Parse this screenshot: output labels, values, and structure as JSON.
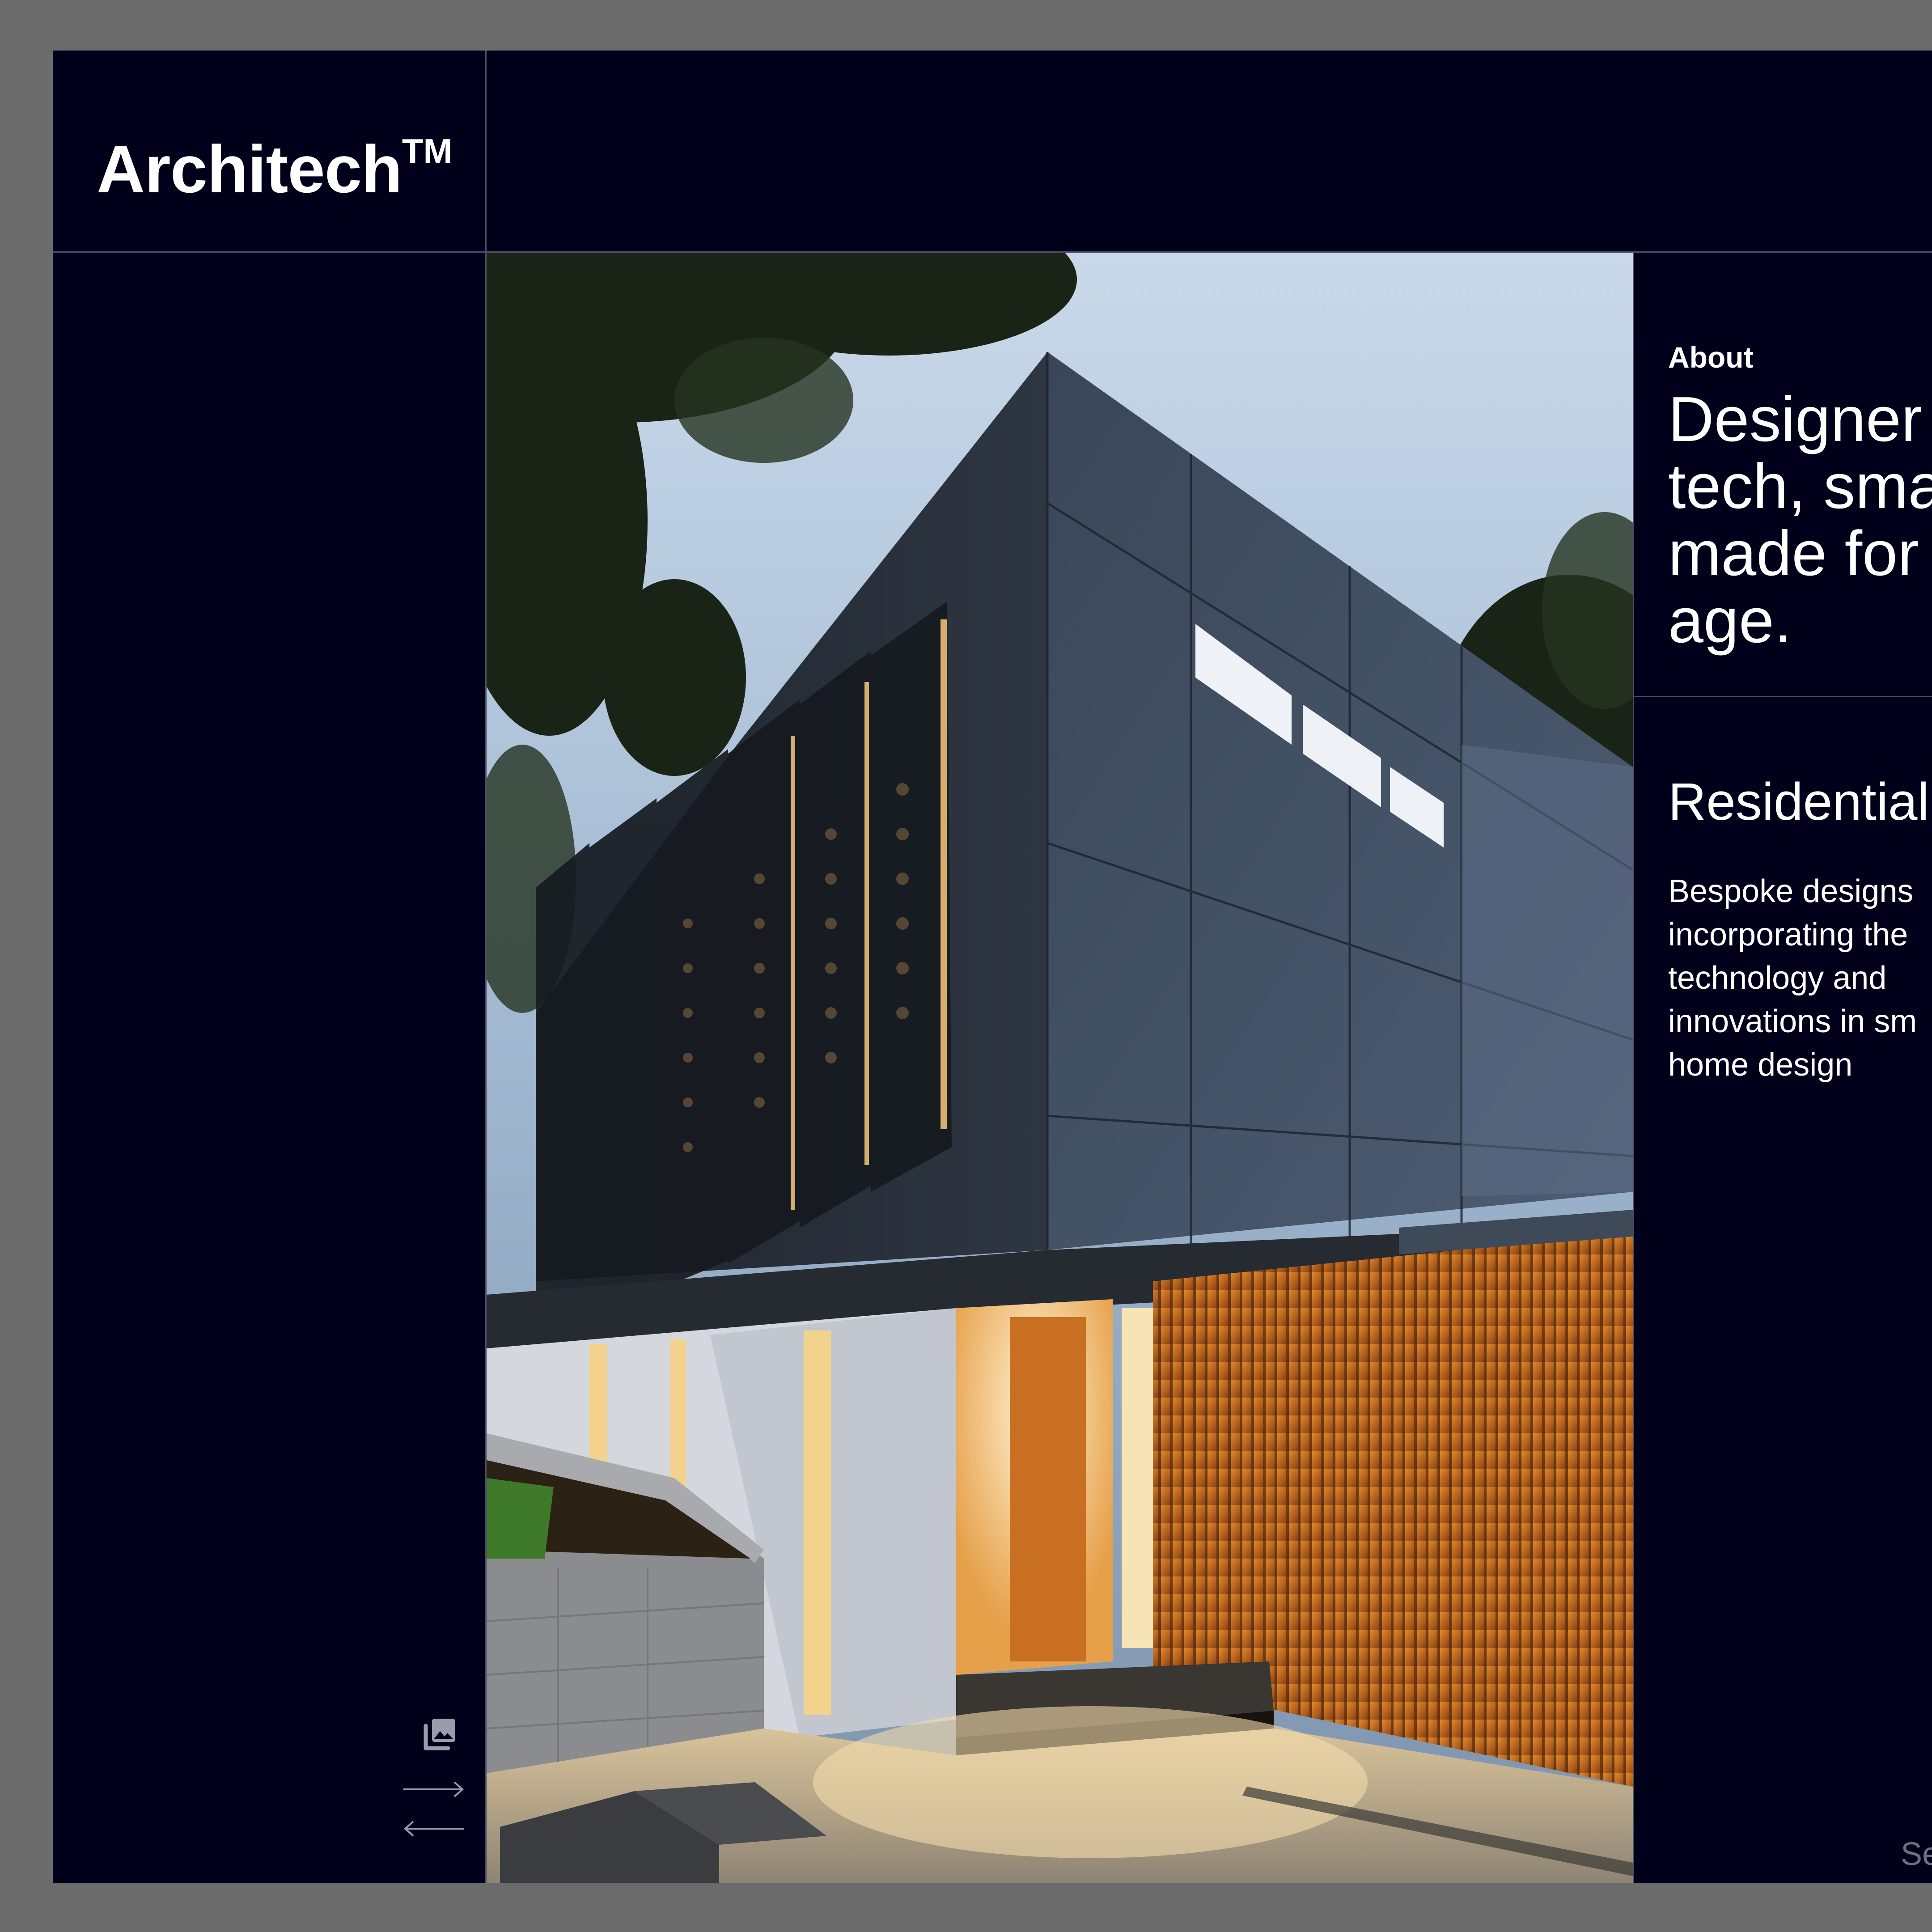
{
  "brand": {
    "name": "Architech",
    "trademark": "TM"
  },
  "photo": {
    "subject": "modern residential house exterior at dusk"
  },
  "nav": {
    "gallery_icon": "gallery-icon",
    "next_icon": "arrow-right-icon",
    "prev_icon": "arrow-left-icon"
  },
  "about": {
    "label": "About",
    "headline": "Designer\ntech, sma\nmade for\nage."
  },
  "section": {
    "title": "Residential",
    "body": "Bespoke designs\nincorporating the\ntechnology and\ninnovations in sm\nhome design"
  },
  "scroll_hint": "Se",
  "colors": {
    "background": "#00001a",
    "outer": "#6b6b6b",
    "divider": "#4a4d63",
    "text": "#ffffff",
    "muted": "#6e7082"
  }
}
